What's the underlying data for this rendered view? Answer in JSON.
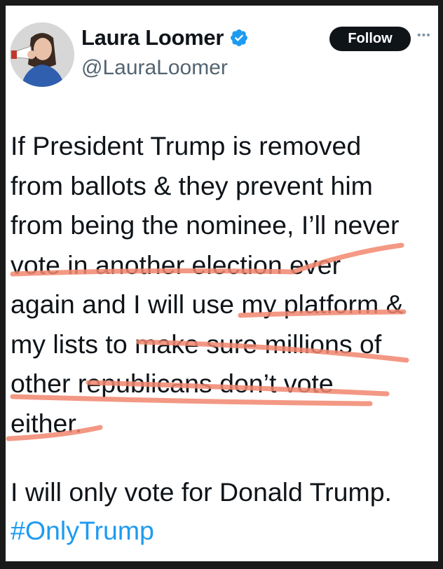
{
  "tweet": {
    "author": {
      "display_name": "Laura Loomer",
      "handle": "@LauraLoomer",
      "verified": true
    },
    "follow_label": "Follow",
    "body_lines": [
      "If President Trump is removed",
      "from ballots & they prevent him",
      "from being the nominee, I’ll never",
      "vote in another election ever",
      "again and I will use my platform &",
      "my lists to make sure millions of",
      "other republicans don’t vote",
      "either."
    ],
    "closing": "I will only vote for Donald Trump.",
    "hashtag": "#OnlyTrump"
  },
  "colors": {
    "verified_badge": "#1d9bf0",
    "hashtag": "#1d9bf0",
    "highlight_underline": "#f2876f"
  }
}
